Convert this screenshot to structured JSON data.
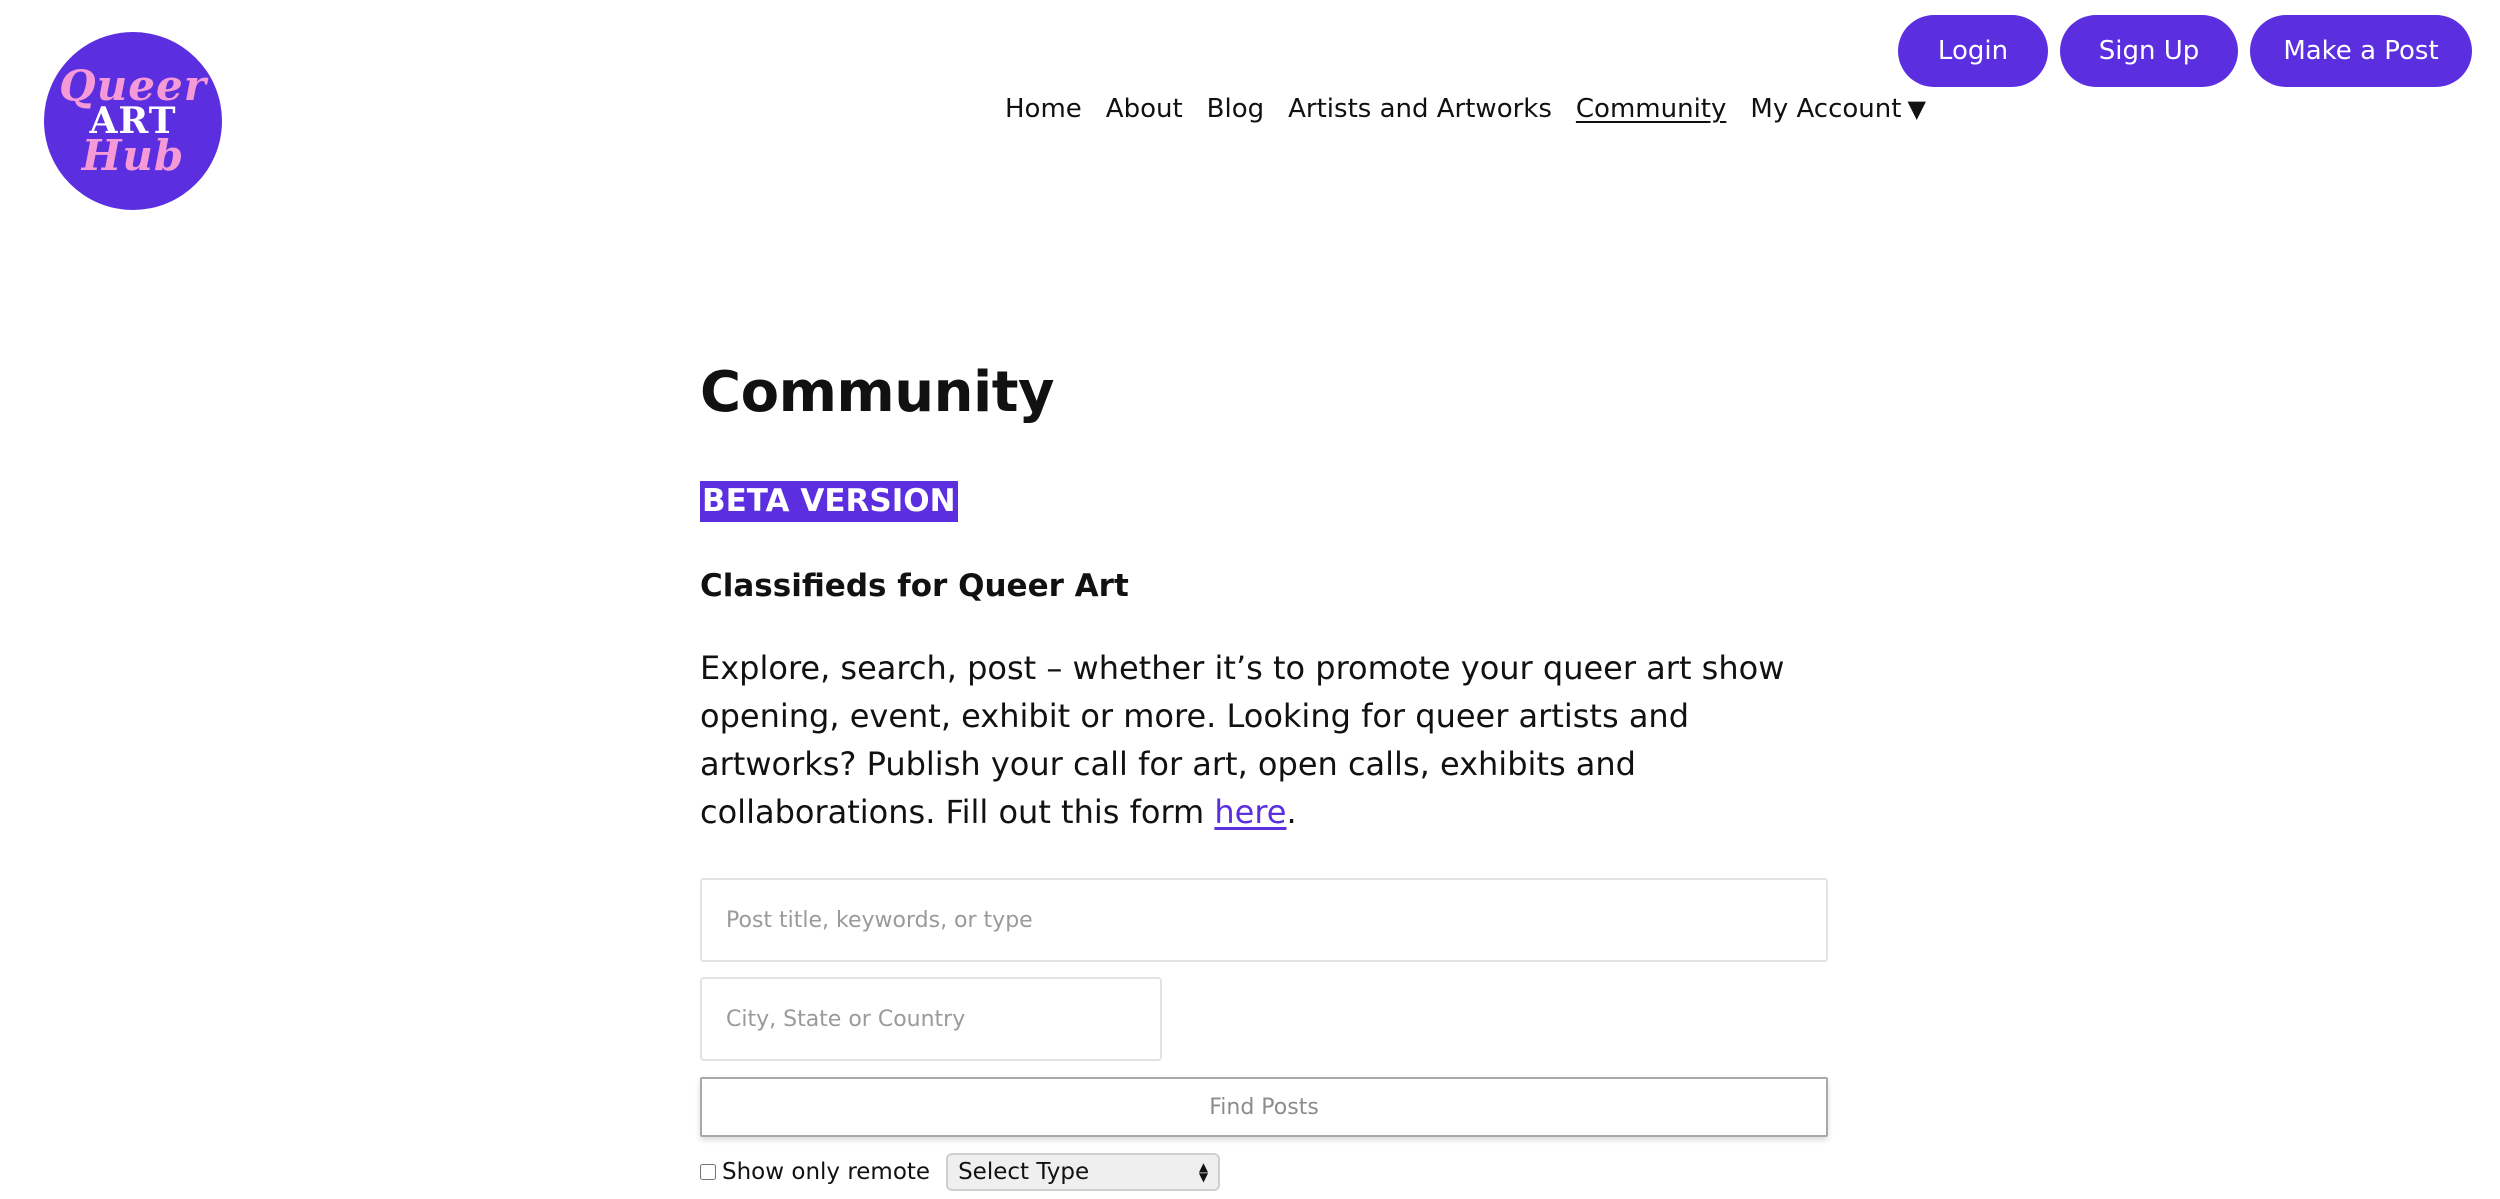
{
  "brand": {
    "logo_line1": "Queer",
    "logo_line2": "ART",
    "logo_line3": "Hub",
    "accent_color": "#5b2fe0",
    "logo_pink": "#f59ad6"
  },
  "header": {
    "login_label": "Login",
    "signup_label": "Sign Up",
    "make_post_label": "Make a Post"
  },
  "nav": {
    "items": [
      {
        "label": "Home"
      },
      {
        "label": "About"
      },
      {
        "label": "Blog"
      },
      {
        "label": "Artists and Artworks"
      },
      {
        "label": "Community",
        "active": true
      },
      {
        "label": "My Account"
      }
    ],
    "dropdown_icon": "▼"
  },
  "main": {
    "title": "Community",
    "badge": "BETA VERSION",
    "subheading": "Classifieds for Queer Art",
    "intro_text": "Explore, search, post – whether it’s to promote your queer art show opening, event, exhibit or more. Looking for queer artists and artworks? Publish your call for art, open calls, exhibits and collaborations. Fill out this form ",
    "intro_link": "here",
    "intro_end": "."
  },
  "search": {
    "keywords_placeholder": "Post title, keywords, or type",
    "location_placeholder": "City, State or Country",
    "submit_label": "Find Posts",
    "remote_label": "Show only remote",
    "remote_checked": false,
    "type_select_value": "Select Type"
  }
}
